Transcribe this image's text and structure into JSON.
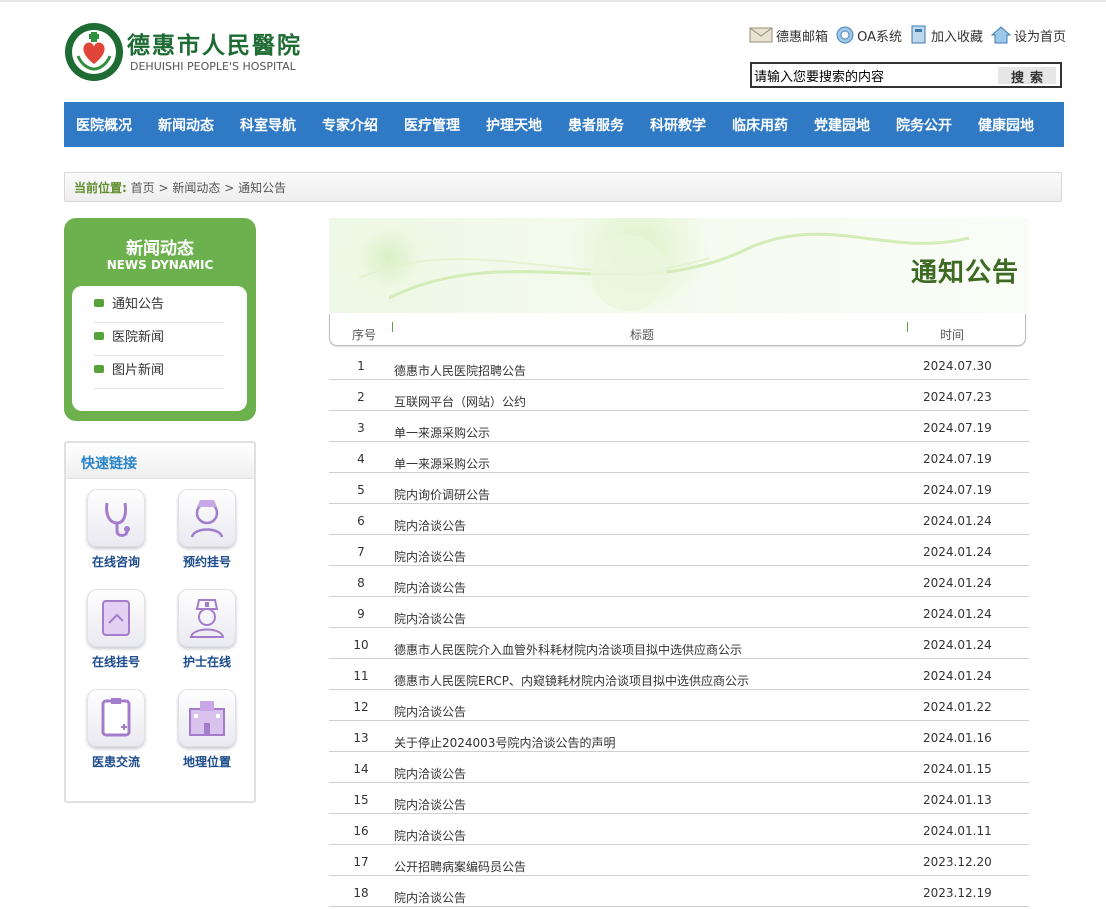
{
  "logo": {
    "name_cn": "德惠市人民醫院",
    "name_en": "DEHUISHI PEOPLE'S HOSPITAL"
  },
  "toplinks": [
    {
      "label": "德惠邮箱",
      "icon": "mail-icon"
    },
    {
      "label": "OA系统",
      "icon": "globe-icon"
    },
    {
      "label": "加入收藏",
      "icon": "bookmark-icon"
    },
    {
      "label": "设为首页",
      "icon": "home-icon"
    }
  ],
  "search": {
    "value": "请输入您要搜索的内容",
    "button": "搜索"
  },
  "nav": [
    "医院概况",
    "新闻动态",
    "科室导航",
    "专家介绍",
    "医疗管理",
    "护理天地",
    "患者服务",
    "科研教学",
    "临床用药",
    "党建园地",
    "院务公开",
    "健康园地"
  ],
  "breadcrumb": {
    "label": "当前位置:",
    "items": [
      "首页",
      "新闻动态",
      "通知公告"
    ],
    "separator": ">"
  },
  "sidebar": {
    "title": "新闻动态",
    "subtitle": "NEWS DYNAMIC",
    "items": [
      "通知公告",
      "医院新闻",
      "图片新闻"
    ]
  },
  "quick": {
    "title": "快速链接",
    "items": [
      {
        "label": "在线咨询",
        "icon": "stethoscope-icon"
      },
      {
        "label": "预约挂号",
        "icon": "nurse-icon"
      },
      {
        "label": "在线挂号",
        "icon": "tablet-icon"
      },
      {
        "label": "护士在线",
        "icon": "nurse-cap-icon"
      },
      {
        "label": "医患交流",
        "icon": "clipboard-icon"
      },
      {
        "label": "地理位置",
        "icon": "hospital-building-icon"
      }
    ]
  },
  "banner": {
    "title": "通知公告"
  },
  "table": {
    "headers": {
      "num": "序号",
      "title": "标题",
      "date": "时间"
    },
    "rows": [
      {
        "num": "1",
        "title": "德惠市人民医院招聘公告",
        "date": "2024.07.30"
      },
      {
        "num": "2",
        "title": "互联网平台（网站）公约",
        "date": "2024.07.23"
      },
      {
        "num": "3",
        "title": "单一来源采购公示",
        "date": "2024.07.19"
      },
      {
        "num": "4",
        "title": "单一来源采购公示",
        "date": "2024.07.19"
      },
      {
        "num": "5",
        "title": "院内询价调研公告",
        "date": "2024.07.19"
      },
      {
        "num": "6",
        "title": "院内洽谈公告",
        "date": "2024.01.24"
      },
      {
        "num": "7",
        "title": "院内洽谈公告",
        "date": "2024.01.24"
      },
      {
        "num": "8",
        "title": "院内洽谈公告",
        "date": "2024.01.24"
      },
      {
        "num": "9",
        "title": "院内洽谈公告",
        "date": "2024.01.24"
      },
      {
        "num": "10",
        "title": "德惠市人民医院介入血管外科耗材院内洽谈项目拟中选供应商公示",
        "date": "2024.01.24"
      },
      {
        "num": "11",
        "title": "德惠市人民医院ERCP、内窥镜耗材院内洽谈项目拟中选供应商公示",
        "date": "2024.01.24"
      },
      {
        "num": "12",
        "title": "院内洽谈公告",
        "date": "2024.01.22"
      },
      {
        "num": "13",
        "title": "关于停止2024003号院内洽谈公告的声明",
        "date": "2024.01.16"
      },
      {
        "num": "14",
        "title": "院内洽谈公告",
        "date": "2024.01.15"
      },
      {
        "num": "15",
        "title": "院内洽谈公告",
        "date": "2024.01.13"
      },
      {
        "num": "16",
        "title": "院内洽谈公告",
        "date": "2024.01.11"
      },
      {
        "num": "17",
        "title": "公开招聘病案编码员公告",
        "date": "2023.12.20"
      },
      {
        "num": "18",
        "title": "院内洽谈公告",
        "date": "2023.12.19"
      }
    ]
  },
  "colors": {
    "nav_bg": "#2f79c5",
    "green": "#6db14f",
    "logo_green": "#1e6b33",
    "quick_title": "#2b86c9"
  }
}
